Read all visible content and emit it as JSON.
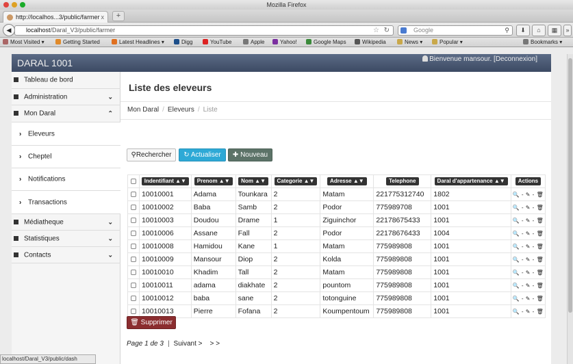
{
  "window": {
    "title": "Mozilla Firefox"
  },
  "tab": {
    "label": "http://localhos...3/public/farmer",
    "close": "x",
    "new_tab": "+"
  },
  "nav": {
    "url_host": "localhost",
    "url_path": "/Daral_V3/public/farmer",
    "search_placeholder": "Google"
  },
  "bookmarks": [
    {
      "label": "Most Visited ▾",
      "icon": "bookmarks-icon",
      "color": "#a66"
    },
    {
      "label": "Getting Started",
      "icon": "firefox-icon",
      "color": "#e08a2a"
    },
    {
      "label": "Latest Headlines ▾",
      "icon": "rss-icon",
      "color": "#e07020"
    },
    {
      "label": "Digg",
      "icon": "digg-icon",
      "color": "#1d4f8a"
    },
    {
      "label": "YouTube",
      "icon": "youtube-icon",
      "color": "#d22"
    },
    {
      "label": "Apple",
      "icon": "apple-icon",
      "color": "#777"
    },
    {
      "label": "Yahoo!",
      "icon": "yahoo-icon",
      "color": "#7b2fa0"
    },
    {
      "label": "Google Maps",
      "icon": "google-maps-icon",
      "color": "#3b8a3b"
    },
    {
      "label": "Wikipedia",
      "icon": "wikipedia-icon",
      "color": "#555"
    },
    {
      "label": "News ▾",
      "icon": "news-folder-icon",
      "color": "#c9a84a"
    },
    {
      "label": "Popular ▾",
      "icon": "popular-folder-icon",
      "color": "#c9a84a"
    },
    {
      "label": "Bookmarks ▾",
      "icon": "bookmarks-menu-icon",
      "color": "#777"
    }
  ],
  "app": {
    "brand": "DARAL 1001",
    "welcome": "Bienvenue mansour. [Deconnexion]"
  },
  "sidebar": {
    "items": [
      {
        "label": "Tableau de bord",
        "icon": "dashboard-icon",
        "sub": false,
        "chevron": ""
      },
      {
        "label": "Administration",
        "icon": "gear-icon",
        "sub": false,
        "chevron": "⌄"
      },
      {
        "label": "Mon Daral",
        "icon": "home-icon",
        "sub": false,
        "chevron": "⌃"
      },
      {
        "label": "Eleveurs",
        "icon": "chevron-right-icon",
        "sub": true,
        "chevron": ""
      },
      {
        "label": "Cheptel",
        "icon": "chevron-right-icon",
        "sub": true,
        "chevron": ""
      },
      {
        "label": "Notifications",
        "icon": "chevron-right-icon",
        "sub": true,
        "chevron": ""
      },
      {
        "label": "Transactions",
        "icon": "chevron-right-icon",
        "sub": true,
        "chevron": ""
      },
      {
        "label": "Médiatheque",
        "icon": "media-icon",
        "sub": false,
        "chevron": "⌄"
      },
      {
        "label": "Statistiques",
        "icon": "filter-icon",
        "sub": false,
        "chevron": "⌄"
      },
      {
        "label": "Contacts",
        "icon": "book-icon",
        "sub": false,
        "chevron": "⌄"
      }
    ]
  },
  "main": {
    "title": "Liste des eleveurs",
    "breadcrumb": [
      "Mon Daral",
      "Eleveurs",
      "Liste"
    ],
    "buttons": {
      "search": "Rechercher",
      "refresh": "Actualiser",
      "new": "Nouveau",
      "delete": "Supprimer"
    },
    "columns": [
      "Indentifiant ▲▼",
      "Prenom ▲▼",
      "Nom ▲▼",
      "Categorie ▲▼",
      "Adresse ▲▼",
      "Telephone",
      "Daral d'appartenance ▲▼",
      "Actions"
    ],
    "rows": [
      [
        "10010001",
        "Adama",
        "Tounkara",
        "2",
        "Matam",
        "221775312740",
        "1802"
      ],
      [
        "10010002",
        "Baba",
        "Samb",
        "2",
        "Podor",
        "775989708",
        "1001"
      ],
      [
        "10010003",
        "Doudou",
        "Drame",
        "1",
        "Ziguinchor",
        "22178675433",
        "1001"
      ],
      [
        "10010006",
        "Assane",
        "Fall",
        "2",
        "Podor",
        "22178676433",
        "1004"
      ],
      [
        "10010008",
        "Hamidou",
        "Kane",
        "1",
        "Matam",
        "775989808",
        "1001"
      ],
      [
        "10010009",
        "Mansour",
        "Diop",
        "2",
        "Kolda",
        "775989808",
        "1001"
      ],
      [
        "10010010",
        "Khadim",
        "Tall",
        "2",
        "Matam",
        "775989808",
        "1001"
      ],
      [
        "10010011",
        "adama",
        "diakhate",
        "2",
        "pountom",
        "775989808",
        "1001"
      ],
      [
        "10010012",
        "baba",
        "sane",
        "2",
        "totonguine",
        "775989808",
        "1001"
      ],
      [
        "10010013",
        "Pierre",
        "Fofana",
        "2",
        "Koumpentoum",
        "775989808",
        "1001"
      ]
    ],
    "row_actions": "🔍 - ✎ - 🗑",
    "pager": {
      "info": "Page 1 de 3",
      "sep": "|",
      "next": "Suivant >",
      "last": "> >"
    }
  },
  "status": {
    "text": "localhost/Daral_V3/public/dash"
  }
}
